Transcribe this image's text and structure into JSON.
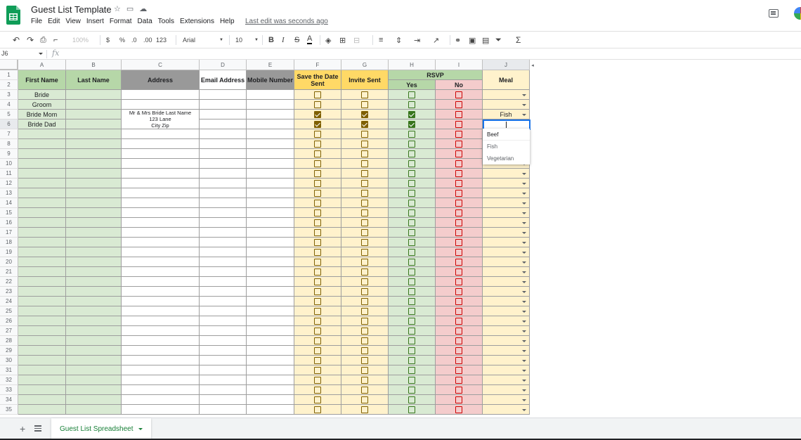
{
  "app": {
    "title": "Guest List Template",
    "last_edit": "Last edit was seconds ago",
    "menu": [
      "File",
      "Edit",
      "View",
      "Insert",
      "Format",
      "Data",
      "Tools",
      "Extensions",
      "Help"
    ]
  },
  "toolbar": {
    "zoom": "100%",
    "currency": "$",
    "percent": "%",
    "decrease_decimal": ".0",
    "increase_decimal": ".00",
    "number_format": "123",
    "font": "Arial",
    "font_size": "10",
    "bold": "B",
    "italic": "I",
    "strike": "S",
    "text_color": "A"
  },
  "formula_bar": {
    "cell_ref": "J6",
    "fx": "fx",
    "value": ""
  },
  "columns": [
    "A",
    "B",
    "C",
    "D",
    "E",
    "F",
    "G",
    "H",
    "I",
    "J"
  ],
  "headers": {
    "first_name": "First Name",
    "last_name": "Last Name",
    "address": "Address",
    "email": "Email Address",
    "mobile": "Mobile Number",
    "save_the_date": "Save the Date Sent",
    "invite_sent": "Invite Sent",
    "rsvp": "RSVP",
    "yes": "Yes",
    "no": "No",
    "meal": "Meal"
  },
  "rows": [
    {
      "num": "3",
      "first_name": "Bride",
      "address": [],
      "save": false,
      "invite": false,
      "yes": false,
      "no": false,
      "meal": ""
    },
    {
      "num": "4",
      "first_name": "Groom",
      "address": [],
      "save": false,
      "invite": false,
      "yes": false,
      "no": false,
      "meal": ""
    },
    {
      "num": "5",
      "first_name": "Bride Mom",
      "address": [
        "Mr & Mrs Bride Last Name",
        "123 Lane",
        "City Zip"
      ],
      "save": true,
      "invite": true,
      "yes": true,
      "no": false,
      "meal": "Fish"
    },
    {
      "num": "6",
      "first_name": "Bride Dad",
      "address": [],
      "save": true,
      "invite": true,
      "yes": true,
      "no": false,
      "meal": ""
    }
  ],
  "empty_row_numbers": [
    "7",
    "8",
    "9",
    "10",
    "11",
    "12",
    "13",
    "14",
    "15",
    "16",
    "17",
    "18",
    "19",
    "20",
    "21",
    "22",
    "23",
    "24",
    "25",
    "26",
    "27",
    "28",
    "29",
    "30",
    "31",
    "32",
    "33",
    "34",
    "35"
  ],
  "header_row_numbers": [
    "1",
    "2"
  ],
  "meal_options": [
    "Beef",
    "Fish",
    "Vegetarian"
  ],
  "sheet_tab": "Guest List Spreadsheet",
  "colors": {
    "green_fill": "#d9ead3",
    "gray_fill": "#999999",
    "yellow_fill": "#fff2cc",
    "header_yellow": "#ffd966",
    "header_green": "#b6d7a8",
    "red_fill": "#f4cccc",
    "checkbox_yellow": "#7f6000",
    "checkbox_green": "#38761d",
    "checkbox_red": "#cc0000"
  }
}
